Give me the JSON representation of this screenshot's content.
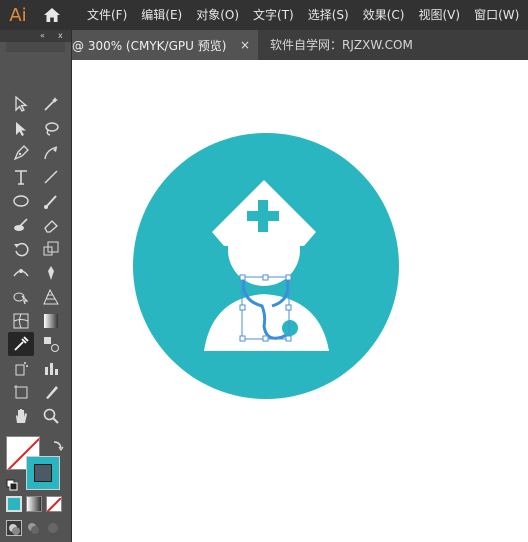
{
  "app": {
    "logo_text": "Ai"
  },
  "menu": [
    {
      "label": "文件(F)"
    },
    {
      "label": "编辑(E)"
    },
    {
      "label": "对象(O)"
    },
    {
      "label": "文字(T)"
    },
    {
      "label": "选择(S)"
    },
    {
      "label": "效果(C)"
    },
    {
      "label": "视图(V)"
    },
    {
      "label": "窗口(W)"
    }
  ],
  "tabs": {
    "active_label": "@ 300% (CMYK/GPU 预览)",
    "close_glyph": "×",
    "inactive_label": "软件自学网：RJZXW.COM"
  },
  "toolbar": {
    "collapse_glyph": "«",
    "close_glyph": "x",
    "tools": [
      [
        "selection-tool-icon",
        "magic-wand-tool-icon"
      ],
      [
        "direct-selection-tool-icon",
        "lasso-tool-icon"
      ],
      [
        "pen-tool-icon",
        "curvature-tool-icon"
      ],
      [
        "type-tool-icon",
        "line-segment-tool-icon"
      ],
      [
        "ellipse-tool-icon",
        "paintbrush-tool-icon"
      ],
      [
        "blob-brush-tool-icon",
        "eraser-tool-icon"
      ],
      [
        "rotate-tool-icon",
        "scale-tool-icon"
      ],
      [
        "width-tool-icon",
        "puppet-warp-tool-icon"
      ],
      [
        "shape-builder-tool-icon",
        "perspective-grid-tool-icon"
      ],
      [
        "mesh-tool-icon",
        "gradient-tool-icon"
      ],
      [
        "eyedropper-tool-icon",
        "blend-tool-icon"
      ],
      [
        "symbol-sprayer-tool-icon",
        "column-graph-tool-icon"
      ],
      [
        "artboard-tool-icon",
        "slice-tool-icon"
      ],
      [
        "hand-tool-icon",
        "zoom-tool-icon"
      ]
    ],
    "selected_tool": "eyedropper-tool-icon"
  },
  "colors": {
    "fill": "#ffffff",
    "stroke": "#2ab6c1",
    "circle": "#2ab6c1",
    "figure": "#ffffff",
    "stethoscope": "#3a8fd8",
    "cross": "#2ab6c1",
    "selection": "#4a90d9"
  }
}
